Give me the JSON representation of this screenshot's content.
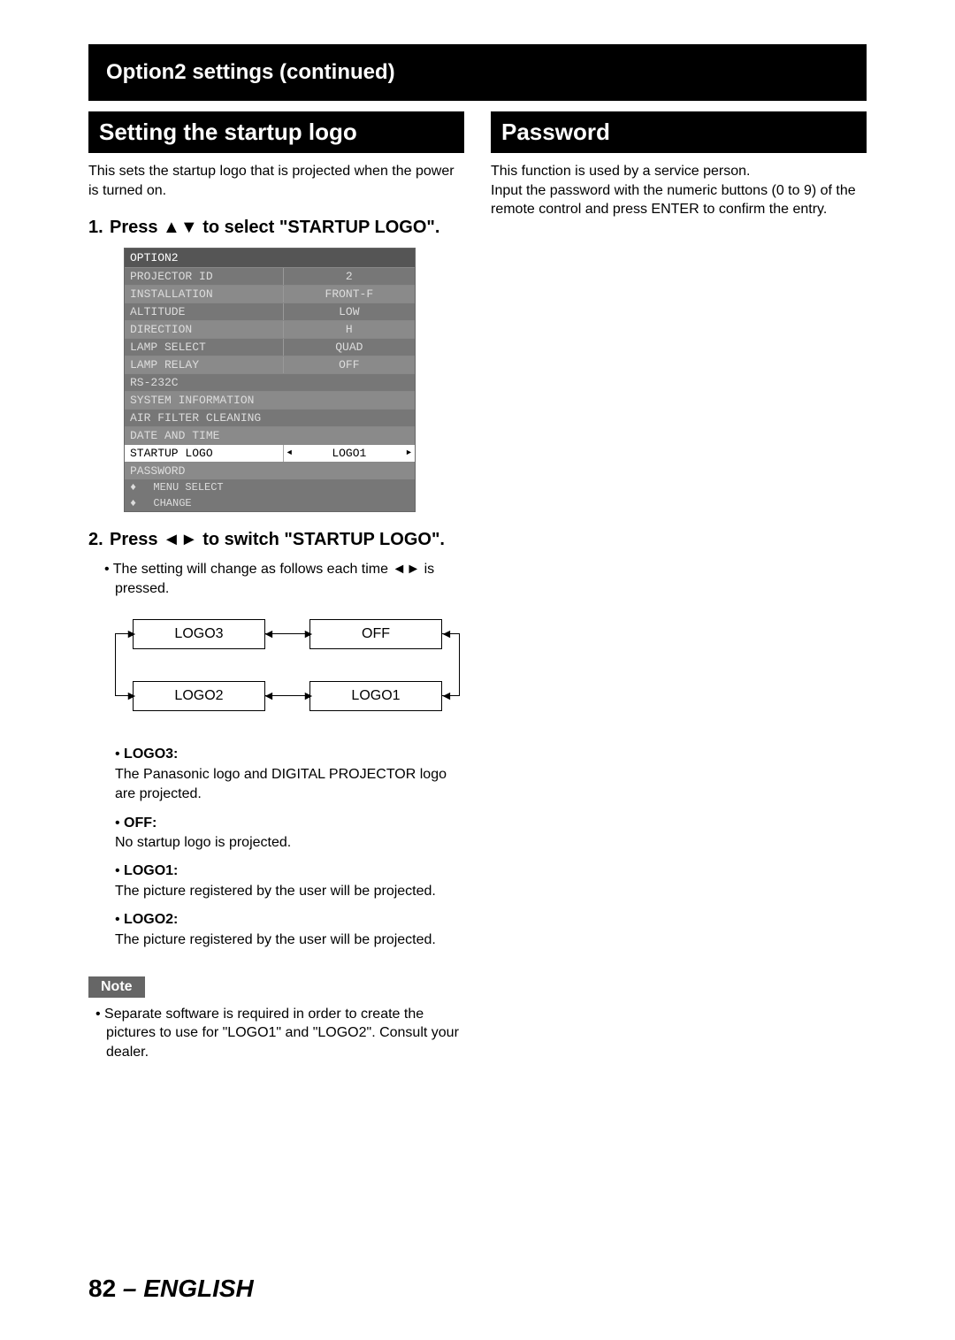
{
  "header": "Option2 settings (continued)",
  "section1": {
    "title": "Setting the startup logo",
    "intro": "This sets the startup logo that is projected when the power is turned on.",
    "step1": "Press ▲▼ to select \"STARTUP LOGO\".",
    "step2": "Press ◄► to switch \"STARTUP LOGO\".",
    "step2_bullet": "The setting will change as follows each time ◄► is pressed.",
    "menu": {
      "title": "OPTION2",
      "rows": [
        {
          "label": "PROJECTOR ID",
          "val": "2"
        },
        {
          "label": "INSTALLATION",
          "val": "FRONT-F"
        },
        {
          "label": "ALTITUDE",
          "val": "LOW"
        },
        {
          "label": "DIRECTION",
          "val": "H"
        },
        {
          "label": "LAMP SELECT",
          "val": "QUAD"
        },
        {
          "label": "LAMP RELAY",
          "val": "OFF"
        },
        {
          "label": "RS-232C",
          "val": ""
        },
        {
          "label": "SYSTEM INFORMATION",
          "val": ""
        },
        {
          "label": "AIR FILTER CLEANING",
          "val": ""
        },
        {
          "label": "DATE AND TIME",
          "val": ""
        },
        {
          "label": "STARTUP LOGO",
          "val": "LOGO1",
          "selected": true
        },
        {
          "label": "PASSWORD",
          "val": ""
        }
      ],
      "footer1": "MENU SELECT",
      "footer2": "CHANGE"
    },
    "cycle": {
      "a": "LOGO3",
      "b": "OFF",
      "c": "LOGO2",
      "d": "LOGO1"
    },
    "defs": [
      {
        "label": "LOGO3:",
        "text": "The Panasonic logo and DIGITAL PROJECTOR logo are projected."
      },
      {
        "label": "OFF:",
        "text": "No startup logo is projected."
      },
      {
        "label": "LOGO1:",
        "text": "The picture registered by the user will be projected."
      },
      {
        "label": "LOGO2:",
        "text": "The picture registered by the user will be projected."
      }
    ],
    "note_label": "Note",
    "note_text": "Separate software is required in order to create the pictures to use for \"LOGO1\" and \"LOGO2\". Consult your dealer."
  },
  "section2": {
    "title": "Password",
    "text": "This function is used by a service person.\nInput the password with the numeric buttons (0 to 9) of the remote control and press ENTER to confirm the entry."
  },
  "footer": {
    "page": "82",
    "lang": "ENGLISH"
  }
}
